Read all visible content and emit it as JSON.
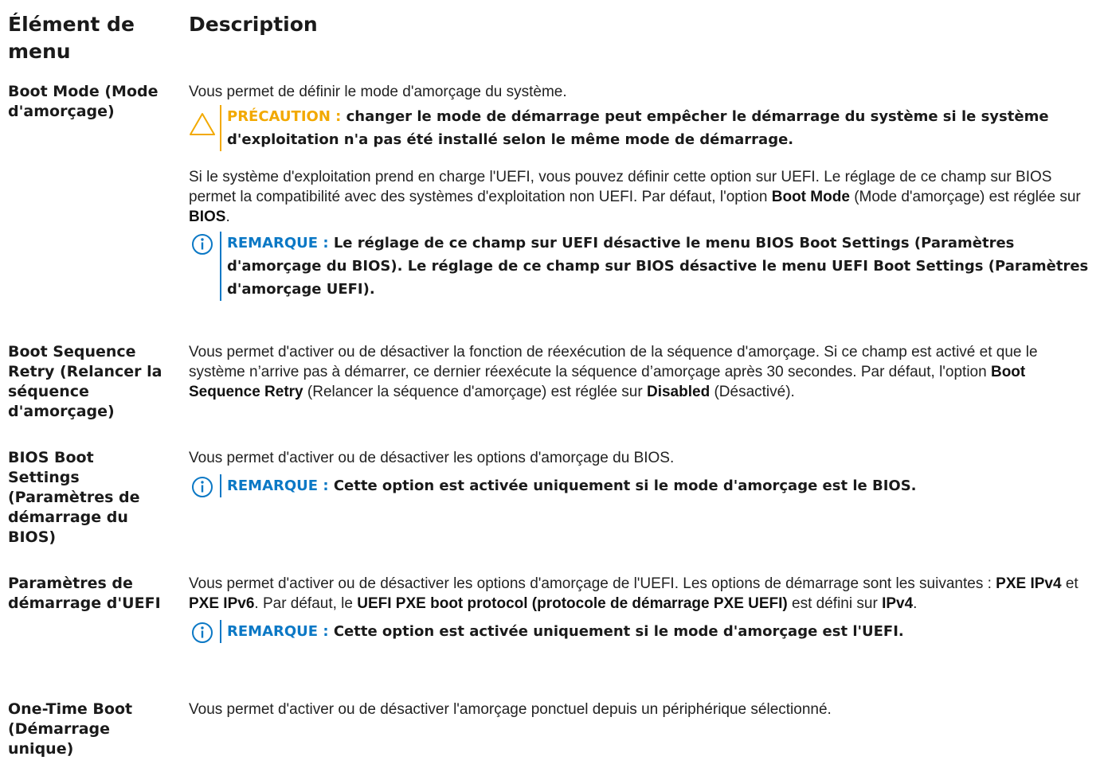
{
  "header": {
    "col1": "Élément de menu",
    "col2": "Description"
  },
  "rows": [
    {
      "term": "Boot Mode (Mode d'amorçage)",
      "p1": "Vous permet de définir le mode d'amorçage du système.",
      "caution_lead": "PRÉCAUTION :",
      "caution_text": "changer le mode de démarrage peut empêcher le démarrage du système si le système d'exploitation n'a pas été installé selon le même mode de démarrage.",
      "p2_a": "Si le système d'exploitation prend en charge l'UEFI, vous pouvez définir cette option sur UEFI. Le réglage de ce champ sur BIOS permet la compatibilité avec des systèmes d'exploitation non UEFI. Par défaut, l'option",
      "p2_b": "Boot Mode",
      "p2_c": "(Mode d'amorçage) est réglée sur",
      "p2_d": "BIOS",
      "p2_e": ".",
      "note_lead": "REMARQUE :",
      "note_text": "Le réglage de ce champ sur UEFI désactive le menu BIOS Boot Settings (Paramètres d'amorçage du BIOS). Le réglage de ce champ sur BIOS désactive le menu UEFI Boot Settings (Paramètres d'amorçage UEFI)."
    },
    {
      "term": "Boot Sequence Retry (Relancer la séquence d'amorçage)",
      "p_a": "Vous permet d'activer ou de désactiver la fonction de réexécution de la séquence d'amorçage. Si ce champ est activé et que le système n’arrive pas à démarrer, ce dernier réexécute la séquence d’amorçage après 30 secondes. Par défaut, l'option",
      "p_b": "Boot Sequence Retry",
      "p_c": "(Relancer la séquence d'amorçage) est réglée sur",
      "p_d": "Disabled",
      "p_e": "(Désactivé)."
    },
    {
      "term": "BIOS Boot Settings (Paramètres de démarrage du BIOS)",
      "p1": "Vous permet d'activer ou de désactiver les options d'amorçage du BIOS.",
      "note_lead": "REMARQUE :",
      "note_text": "Cette option est activée uniquement si le mode d'amorçage est le BIOS."
    },
    {
      "term": "Paramètres de démarrage d'UEFI",
      "p_a": "Vous permet d'activer ou de désactiver les options d'amorçage de l'UEFI. Les options de démarrage sont les suivantes :",
      "p_b": "PXE IPv4",
      "p_c": "et",
      "p_d": "PXE IPv6",
      "p_e": ". Par défaut, le",
      "p_f": "UEFI PXE boot protocol (protocole de démarrage PXE UEFI)",
      "p_g": "est défini sur",
      "p_h": "IPv4",
      "p_i": ".",
      "note_lead": "REMARQUE :",
      "note_text": "Cette option est activée uniquement si le mode d'amorçage est l'UEFI."
    },
    {
      "term": "One-Time Boot (Démarrage unique)",
      "p1": "Vous permet d'activer ou de désactiver l'amorçage ponctuel depuis un périphérique sélectionné."
    }
  ],
  "icons": {
    "caution": "caution-triangle-icon",
    "note": "info-circle-icon"
  },
  "colors": {
    "caution": "#f2a900",
    "note": "#0b78c5"
  }
}
